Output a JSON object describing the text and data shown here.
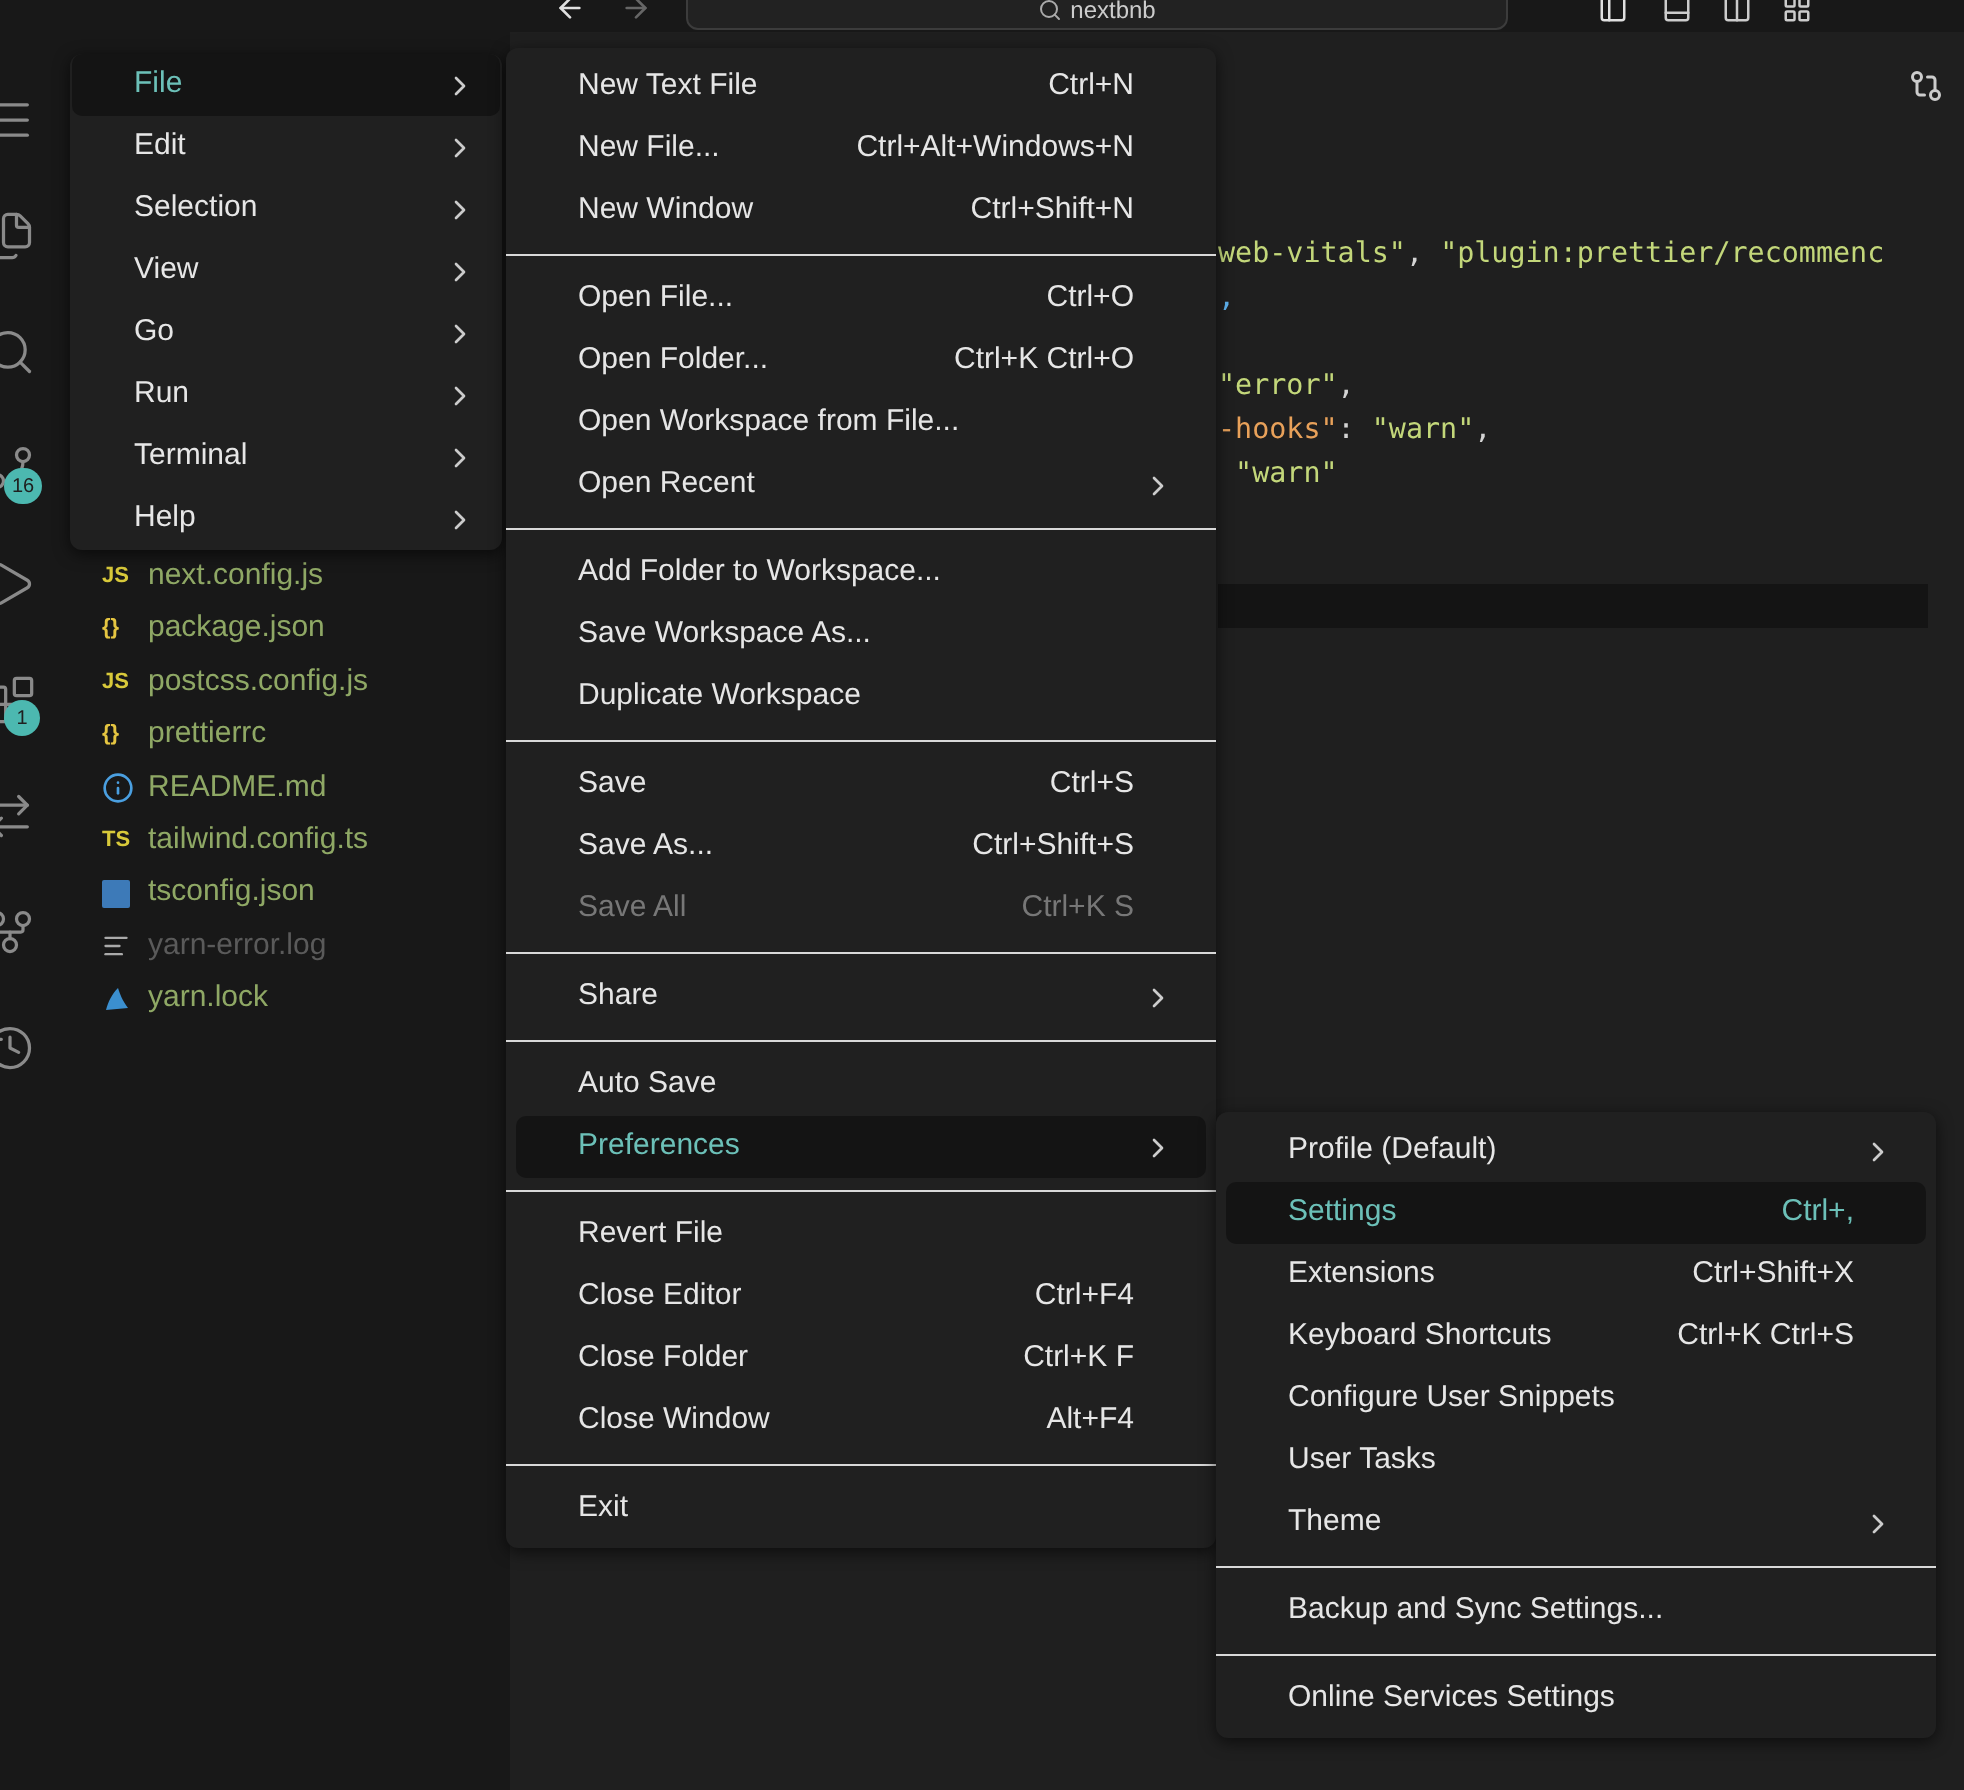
{
  "title_bar": {
    "search": "nextbnb"
  },
  "activity_bar": [
    {
      "kind": "menu"
    },
    {
      "kind": "explorer"
    },
    {
      "kind": "search"
    },
    {
      "kind": "source-control",
      "badge": "16"
    },
    {
      "kind": "run"
    },
    {
      "kind": "extensions",
      "badge": "1"
    },
    {
      "kind": "remote"
    },
    {
      "kind": "git-graph"
    },
    {
      "kind": "history"
    }
  ],
  "explorer": {
    "files": [
      {
        "name": "next.config.js",
        "kind": "text",
        "icon": "JS",
        "ignored": false
      },
      {
        "name": "package.json",
        "kind": "text",
        "icon": "{}",
        "ignored": false
      },
      {
        "name": "postcss.config.js",
        "kind": "text",
        "icon": "JS",
        "ignored": false
      },
      {
        "name": "prettierrc",
        "kind": "text",
        "icon": "{}",
        "ignored": false
      },
      {
        "name": "README.md",
        "kind": "info",
        "ignored": false
      },
      {
        "name": "tailwind.config.ts",
        "kind": "text",
        "icon": "TS",
        "ignored": false
      },
      {
        "name": "tsconfig.json",
        "kind": "tsconfig",
        "ignored": false
      },
      {
        "name": "yarn-error.log",
        "kind": "log",
        "ignored": true
      },
      {
        "name": "yarn.lock",
        "kind": "yarn",
        "ignored": false
      }
    ]
  },
  "editor": {
    "lines": [
      {
        "kind": "code",
        "tokens": [
          {
            "kind": "string",
            "text": "web-vitals\""
          },
          {
            "kind": "punct",
            "text": ", "
          },
          {
            "kind": "string",
            "text": "\"plugin:prettier/recommenc"
          }
        ]
      },
      {
        "kind": "code",
        "tokens": [
          {
            "kind": "accent",
            "text": ","
          }
        ]
      },
      {
        "kind": "blank"
      },
      {
        "kind": "code",
        "tokens": [
          {
            "kind": "string",
            "text": "\"error\""
          },
          {
            "kind": "punct",
            "text": ","
          }
        ]
      },
      {
        "kind": "code",
        "tokens": [
          {
            "kind": "key",
            "text": "-hooks\""
          },
          {
            "kind": "punct",
            "text": ": "
          },
          {
            "kind": "string",
            "text": "\"warn\""
          },
          {
            "kind": "punct",
            "text": ","
          }
        ]
      },
      {
        "kind": "code",
        "tokens": [
          {
            "kind": "string",
            "text": " \"warn\""
          }
        ]
      },
      {
        "kind": "blank"
      },
      {
        "kind": "blank"
      },
      {
        "kind": "current"
      }
    ]
  },
  "main_menu": [
    {
      "label": "File",
      "selected": true
    },
    {
      "label": "Edit",
      "selected": false
    },
    {
      "label": "Selection",
      "selected": false
    },
    {
      "label": "View",
      "selected": false
    },
    {
      "label": "Go",
      "selected": false
    },
    {
      "label": "Run",
      "selected": false
    },
    {
      "label": "Terminal",
      "selected": false
    },
    {
      "label": "Help",
      "selected": false
    }
  ],
  "file_menu": [
    [
      {
        "label": "New Text File",
        "shortcut": "Ctrl+N",
        "submenu": false,
        "disabled": false,
        "selected": false
      },
      {
        "label": "New File...",
        "shortcut": "Ctrl+Alt+Windows+N",
        "submenu": false,
        "disabled": false,
        "selected": false
      },
      {
        "label": "New Window",
        "shortcut": "Ctrl+Shift+N",
        "submenu": false,
        "disabled": false,
        "selected": false
      }
    ],
    [
      {
        "label": "Open File...",
        "shortcut": "Ctrl+O",
        "submenu": false,
        "disabled": false,
        "selected": false
      },
      {
        "label": "Open Folder...",
        "shortcut": "Ctrl+K Ctrl+O",
        "submenu": false,
        "disabled": false,
        "selected": false
      },
      {
        "label": "Open Workspace from File...",
        "submenu": false,
        "disabled": false,
        "selected": false
      },
      {
        "label": "Open Recent",
        "submenu": true,
        "disabled": false,
        "selected": false
      }
    ],
    [
      {
        "label": "Add Folder to Workspace...",
        "submenu": false,
        "disabled": false,
        "selected": false
      },
      {
        "label": "Save Workspace As...",
        "submenu": false,
        "disabled": false,
        "selected": false
      },
      {
        "label": "Duplicate Workspace",
        "submenu": false,
        "disabled": false,
        "selected": false
      }
    ],
    [
      {
        "label": "Save",
        "shortcut": "Ctrl+S",
        "submenu": false,
        "disabled": false,
        "selected": false
      },
      {
        "label": "Save As...",
        "shortcut": "Ctrl+Shift+S",
        "submenu": false,
        "disabled": false,
        "selected": false
      },
      {
        "label": "Save All",
        "shortcut": "Ctrl+K S",
        "submenu": false,
        "disabled": true,
        "selected": false
      }
    ],
    [
      {
        "label": "Share",
        "submenu": true,
        "disabled": false,
        "selected": false
      }
    ],
    [
      {
        "label": "Auto Save",
        "submenu": false,
        "disabled": false,
        "selected": false
      },
      {
        "label": "Preferences",
        "submenu": true,
        "disabled": false,
        "selected": true
      }
    ],
    [
      {
        "label": "Revert File",
        "submenu": false,
        "disabled": false,
        "selected": false
      },
      {
        "label": "Close Editor",
        "shortcut": "Ctrl+F4",
        "submenu": false,
        "disabled": false,
        "selected": false
      },
      {
        "label": "Close Folder",
        "shortcut": "Ctrl+K F",
        "submenu": false,
        "disabled": false,
        "selected": false
      },
      {
        "label": "Close Window",
        "shortcut": "Alt+F4",
        "submenu": false,
        "disabled": false,
        "selected": false
      }
    ],
    [
      {
        "label": "Exit",
        "submenu": false,
        "disabled": false,
        "selected": false
      }
    ]
  ],
  "preferences_menu": [
    [
      {
        "label": "Profile (Default)",
        "submenu": true,
        "disabled": false,
        "selected": false
      },
      {
        "label": "Settings",
        "shortcut": "Ctrl+,",
        "submenu": false,
        "disabled": false,
        "selected": true
      },
      {
        "label": "Extensions",
        "shortcut": "Ctrl+Shift+X",
        "submenu": false,
        "disabled": false,
        "selected": false
      },
      {
        "label": "Keyboard Shortcuts",
        "shortcut": "Ctrl+K Ctrl+S",
        "submenu": false,
        "disabled": false,
        "selected": false
      },
      {
        "label": "Configure User Snippets",
        "submenu": false,
        "disabled": false,
        "selected": false
      },
      {
        "label": "User Tasks",
        "submenu": false,
        "disabled": false,
        "selected": false
      },
      {
        "label": "Theme",
        "submenu": true,
        "disabled": false,
        "selected": false
      }
    ],
    [
      {
        "label": "Backup and Sync Settings...",
        "submenu": false,
        "disabled": false,
        "selected": false
      }
    ],
    [
      {
        "label": "Online Services Settings",
        "submenu": false,
        "disabled": false,
        "selected": false
      }
    ]
  ]
}
